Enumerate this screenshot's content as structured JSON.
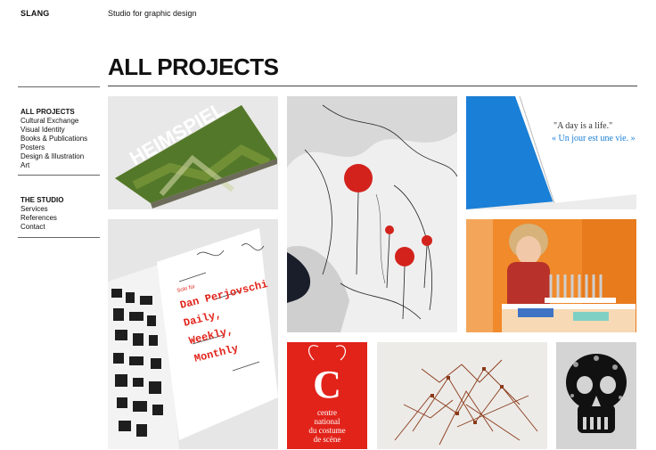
{
  "header": {
    "brand": "SLANG",
    "tagline": "Studio for graphic design"
  },
  "page": {
    "title": "ALL PROJECTS"
  },
  "sidebar": {
    "projects_heading": "ALL PROJECTS",
    "project_items": [
      "Cultural Exchange",
      "Visual Identity",
      "Books & Publications",
      "Posters",
      "Design & Illustration",
      "Art"
    ],
    "studio_heading": "THE STUDIO",
    "studio_items": [
      "Services",
      "References",
      "Contact"
    ]
  },
  "thumbnails": {
    "heimspiel": {
      "text": "HEIMSPIEL"
    },
    "quote_book": {
      "line1": "\"A day is a life.\"",
      "line2": "« Un jour est une vie. »"
    },
    "perjovschi": {
      "solo": "Solo für",
      "name": "Dan Perjovschi",
      "l1": "Daily,",
      "l2": "Weekly,",
      "l3": "Monthly"
    },
    "costume": {
      "letter": "C",
      "l1": "centre",
      "l2": "national",
      "l3": "du costume",
      "l4": "de scène"
    }
  },
  "colors": {
    "accent_red": "#e2231a",
    "blue": "#1a7fd6",
    "orange": "#f08a2a"
  }
}
